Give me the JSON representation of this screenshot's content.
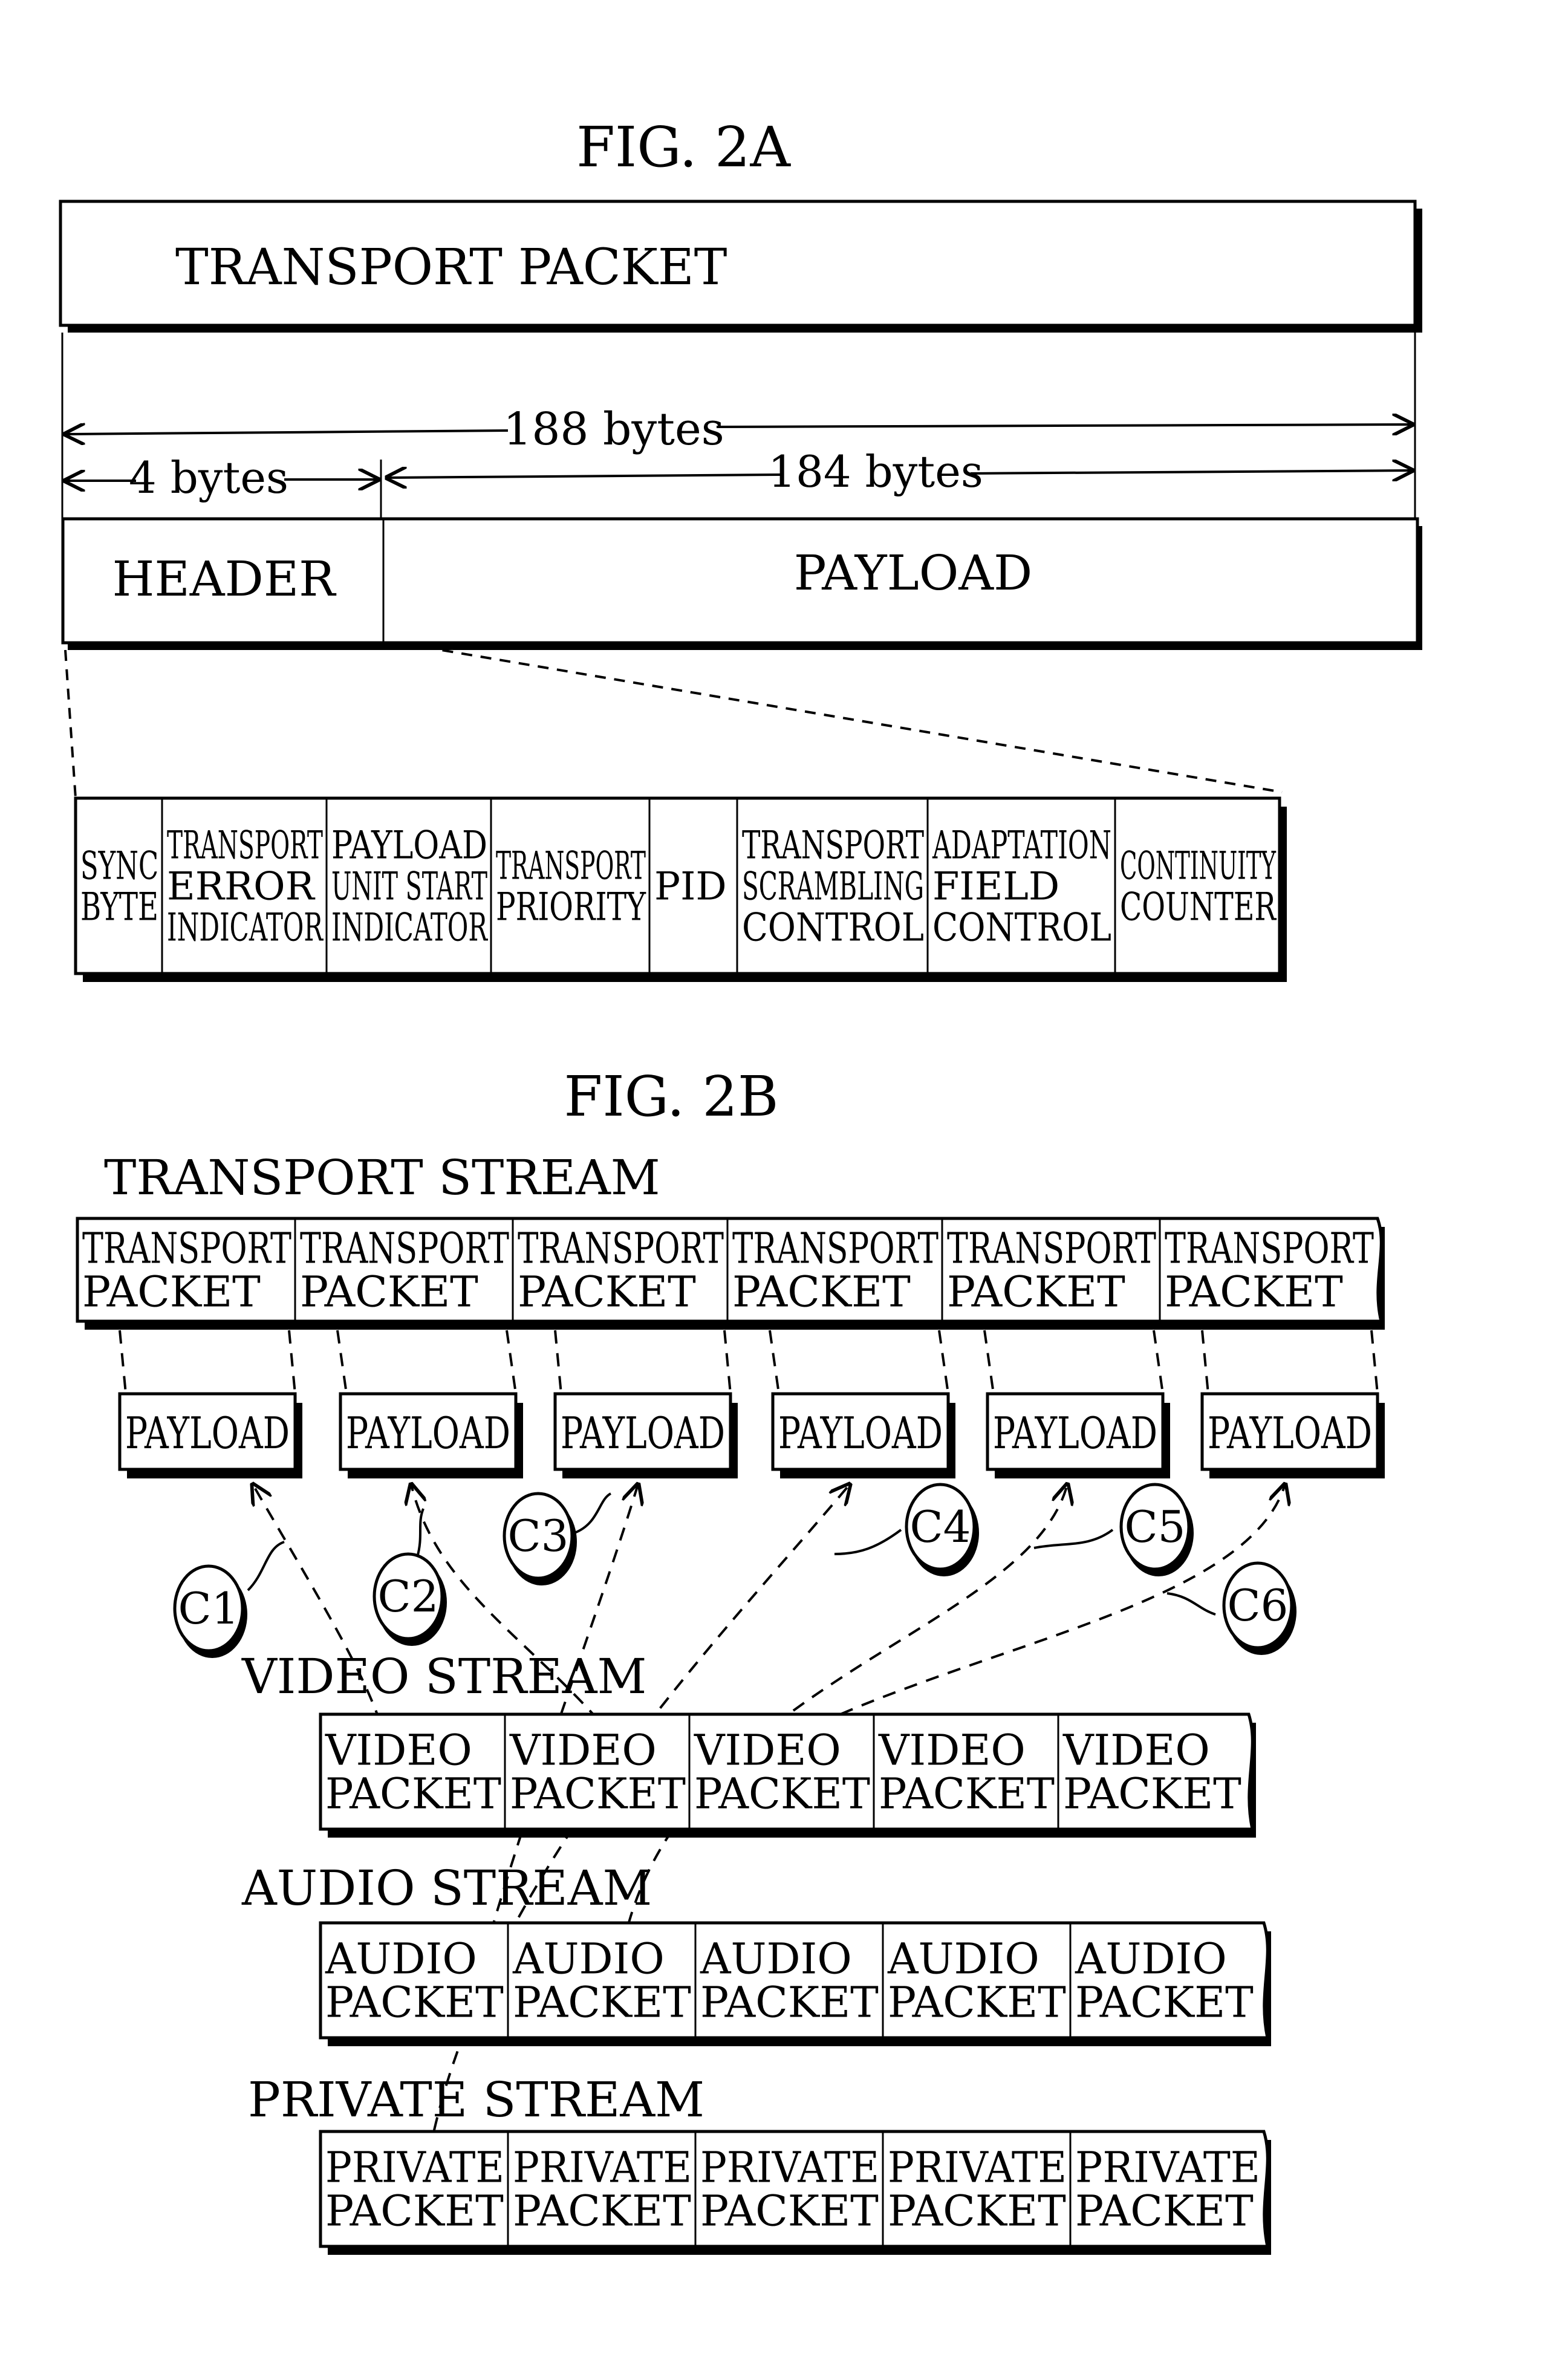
{
  "fig2a": {
    "title": "FIG. 2A",
    "transport_packet_label": "TRANSPORT PACKET",
    "total_size": "188 bytes",
    "header_size": "4 bytes",
    "payload_size": "184 bytes",
    "header_label": "HEADER",
    "payload_label": "PAYLOAD",
    "header_fields": [
      [
        "SYNC",
        "BYTE"
      ],
      [
        "TRANSPORT",
        "ERROR",
        "INDICATOR"
      ],
      [
        "PAYLOAD",
        "UNIT START",
        "INDICATOR"
      ],
      [
        "TRANSPORT",
        "PRIORITY"
      ],
      [
        "PID"
      ],
      [
        "TRANSPORT",
        "SCRAMBLING",
        "CONTROL"
      ],
      [
        "ADAPTATION",
        "FIELD",
        "CONTROL"
      ],
      [
        "CONTINUITY",
        "COUNTER"
      ]
    ]
  },
  "fig2b": {
    "title": "FIG. 2B",
    "transport_stream_label": "TRANSPORT STREAM",
    "transport_packets": [
      [
        "TRANSPORT",
        "PACKET"
      ],
      [
        "TRANSPORT",
        "PACKET"
      ],
      [
        "TRANSPORT",
        "PACKET"
      ],
      [
        "TRANSPORT",
        "PACKET"
      ],
      [
        "TRANSPORT",
        "PACKET"
      ],
      [
        "TRANSPORT",
        "PACKET"
      ]
    ],
    "payloads": [
      "PAYLOAD",
      "PAYLOAD",
      "PAYLOAD",
      "PAYLOAD",
      "PAYLOAD",
      "PAYLOAD"
    ],
    "connection_labels": [
      "C1",
      "C2",
      "C3",
      "C4",
      "C5",
      "C6"
    ],
    "video_stream_label": "VIDEO STREAM",
    "video_packets": [
      [
        "VIDEO",
        "PACKET"
      ],
      [
        "VIDEO",
        "PACKET"
      ],
      [
        "VIDEO",
        "PACKET"
      ],
      [
        "VIDEO",
        "PACKET"
      ],
      [
        "VIDEO",
        "PACKET"
      ]
    ],
    "audio_stream_label": "AUDIO STREAM",
    "audio_packets": [
      [
        "AUDIO",
        "PACKET"
      ],
      [
        "AUDIO",
        "PACKET"
      ],
      [
        "AUDIO",
        "PACKET"
      ],
      [
        "AUDIO",
        "PACKET"
      ],
      [
        "AUDIO",
        "PACKET"
      ]
    ],
    "private_stream_label": "PRIVATE STREAM",
    "private_packets": [
      [
        "PRIVATE",
        "PACKET"
      ],
      [
        "PRIVATE",
        "PACKET"
      ],
      [
        "PRIVATE",
        "PACKET"
      ],
      [
        "PRIVATE",
        "PACKET"
      ],
      [
        "PRIVATE",
        "PACKET"
      ]
    ]
  }
}
